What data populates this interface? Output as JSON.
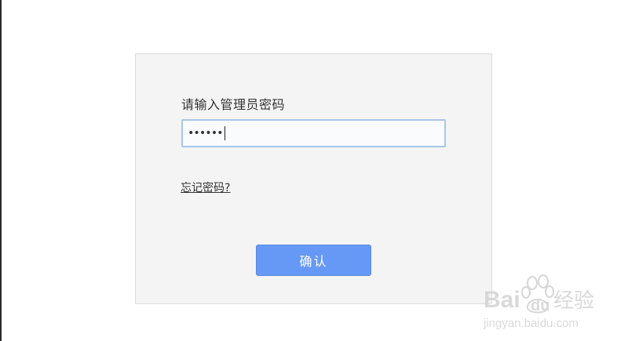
{
  "login": {
    "prompt": "请输入管理员密码",
    "password_mask": "••••••",
    "forgot_link": "忘记密码?",
    "confirm_button": "确认"
  },
  "watermark": {
    "brand": "Bai du 经验",
    "url": "jingyan.baidu.com"
  },
  "colors": {
    "panel_background": "#f4f4f4",
    "input_border": "#a9c6e8",
    "button_background": "#6699f5",
    "button_text": "#ffffff"
  }
}
